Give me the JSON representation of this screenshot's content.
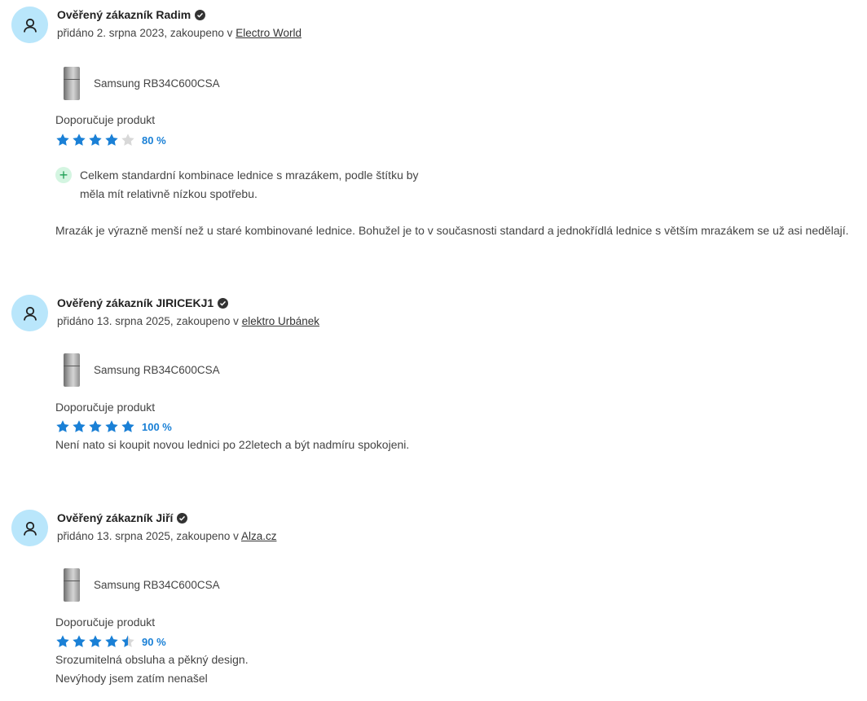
{
  "reviews": [
    {
      "author": "Ověřený zákazník Radim",
      "added_prefix": "přidáno 2. srpna 2023, zakoupeno v",
      "shop": "Electro World",
      "product": "Samsung RB34C600CSA",
      "recommend": "Doporučuje produkt",
      "rating_percent": "80 %",
      "rating_value": 4,
      "pros": [
        "Celkem standardní kombinace lednice s mrazákem, podle štítku by měla mít relativně nízkou spotřebu."
      ],
      "text_lines": [
        "Mrazák je výrazně menší než u staré kombinované lednice. Bohužel je to v současnosti standard a jednokřídlá lednice s větším mrazákem se už asi nedělají."
      ]
    },
    {
      "author": "Ověřený zákazník JIRICEKJ1",
      "added_prefix": "přidáno 13. srpna 2025, zakoupeno v",
      "shop": "elektro Urbánek",
      "product": "Samsung RB34C600CSA",
      "recommend": "Doporučuje produkt",
      "rating_percent": "100 %",
      "rating_value": 5,
      "pros": [],
      "text_lines": [
        "Není nato si koupit novou lednici po 22letech a být nadmíru spokojeni."
      ]
    },
    {
      "author": "Ověřený zákazník Jiří",
      "added_prefix": "přidáno 13. srpna 2025, zakoupeno v",
      "shop": "Alza.cz",
      "product": "Samsung RB34C600CSA",
      "recommend": "Doporučuje produkt",
      "rating_percent": "90 %",
      "rating_value": 4.5,
      "pros": [],
      "text_lines": [
        "Srozumitelná obsluha a pěkný design.",
        "Nevýhody jsem zatím nenašel"
      ]
    }
  ],
  "icons": {
    "avatar": "user-icon",
    "verified": "check-badge-icon",
    "product": "fridge-thumbnail",
    "pro": "plus-icon",
    "star": "star-icon"
  },
  "colors": {
    "star_filled": "#1a80d6",
    "star_empty": "#d8d8d8",
    "avatar_bg": "#b9e6fb",
    "pro_bg": "#d4f5e1",
    "pro_icon": "#1e9f54"
  }
}
